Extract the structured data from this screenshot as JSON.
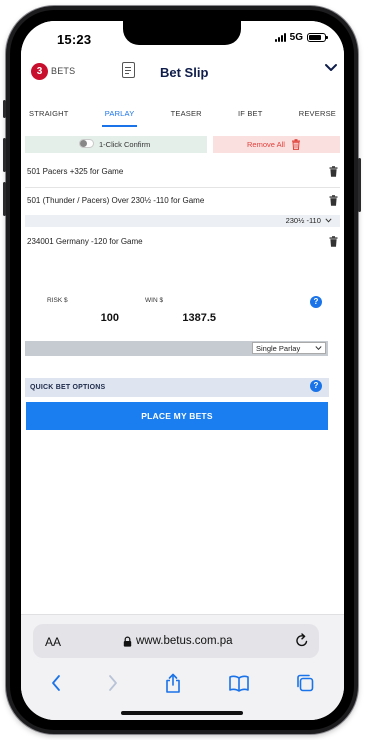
{
  "status_bar": {
    "time": "15:23",
    "network": "5G"
  },
  "header": {
    "bets_count": "3",
    "bets_label": "BETS",
    "title": "Bet Slip"
  },
  "tabs": [
    {
      "label": "STRAIGHT",
      "active": false
    },
    {
      "label": "PARLAY",
      "active": true
    },
    {
      "label": "TEASER",
      "active": false
    },
    {
      "label": "IF BET",
      "active": false
    },
    {
      "label": "REVERSE",
      "active": false
    }
  ],
  "controls": {
    "one_click_label": "1-Click Confirm",
    "one_click_enabled": false,
    "remove_all_label": "Remove All"
  },
  "bets": [
    {
      "text": "501 Pacers +325 for Game"
    },
    {
      "text": "501 (Thunder / Pacers) Over 230½ -110 for Game",
      "selected_odds": "230½ -110"
    },
    {
      "text": "234001 Germany -120 for Game"
    }
  ],
  "stake": {
    "risk_label": "RISK $",
    "win_label": "WIN $",
    "risk_value": "100",
    "win_value": "1387.5"
  },
  "parlay_type": {
    "selected": "Single Parlay"
  },
  "quick_bet": {
    "label": "QUICK BET OPTIONS"
  },
  "place_button": {
    "label": "PLACE MY BETS"
  },
  "browser": {
    "aa_label": "AA",
    "url": "www.betus.com.pa"
  },
  "colors": {
    "accent_blue": "#1a7ef0",
    "badge_red": "#c8102e",
    "remove_red": "#e0413a",
    "title_navy": "#0f1d4a"
  }
}
